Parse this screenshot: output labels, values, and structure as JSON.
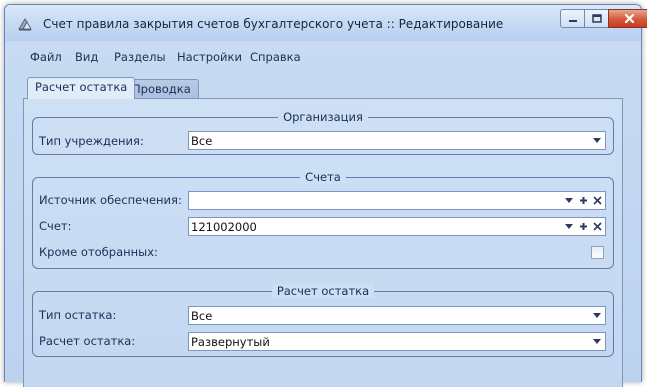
{
  "window": {
    "title": "Счет правила закрытия счетов бухгалтерского учета :: Редактирование"
  },
  "menu": [
    "Файл",
    "Вид",
    "Разделы",
    "Настройки",
    "Справка"
  ],
  "tabs": [
    {
      "label": "Расчет остатка",
      "active": true
    },
    {
      "label": "Проводка",
      "active": false
    }
  ],
  "groups": {
    "organization": {
      "title": "Организация",
      "institution_type_label": "Тип учреждения:",
      "institution_type_value": "Все"
    },
    "accounts": {
      "title": "Счета",
      "funding_source_label": "Источник обеспечения:",
      "funding_source_value": "",
      "account_label": "Счет:",
      "account_value": "121002000",
      "except_selected_label": "Кроме отобранных:",
      "except_selected_checked": false
    },
    "balance": {
      "title": "Расчет остатка",
      "balance_type_label": "Тип остатка:",
      "balance_type_value": "Все",
      "balance_calc_label": "Расчет остатка:",
      "balance_calc_value": "Развернутый"
    }
  },
  "icons": {
    "app": "app-icon",
    "minimize": "minimize-icon",
    "maximize": "maximize-icon",
    "close": "close-icon",
    "dropdown": "dropdown-arrow-icon",
    "add": "plus-icon",
    "clear": "clear-x-icon"
  },
  "colors": {
    "window_bg": "#c3d7f1",
    "border": "#5f7cab",
    "close_button": "#d5583c"
  }
}
